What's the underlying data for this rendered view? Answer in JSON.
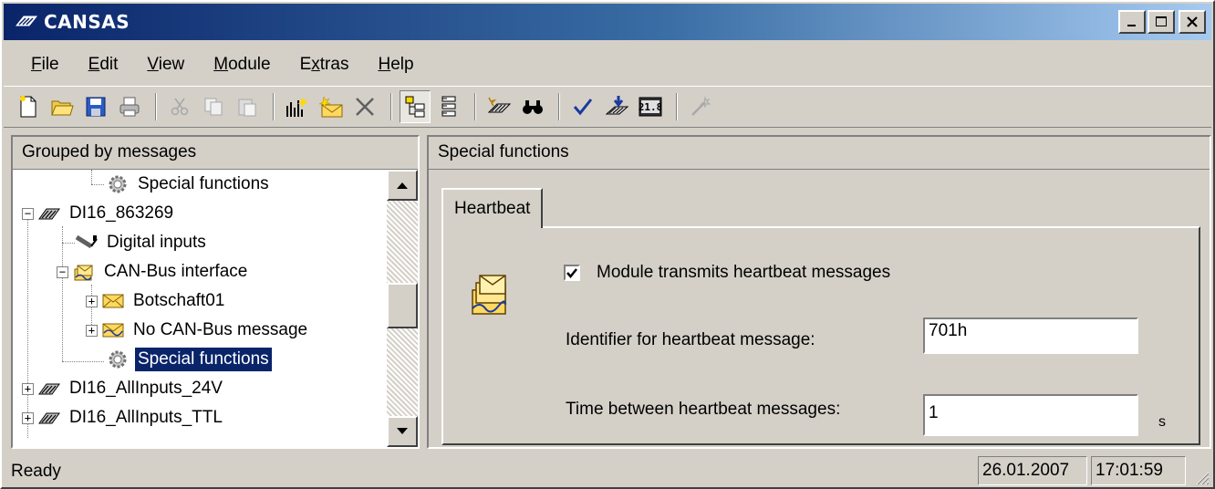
{
  "window": {
    "title": "CANSAS"
  },
  "menu": [
    "File",
    "Edit",
    "View",
    "Module",
    "Extras",
    "Help"
  ],
  "menu_mnemonics": [
    "F",
    "E",
    "V",
    "M",
    "x",
    "H"
  ],
  "toolbar": [
    "new-icon",
    "open-icon",
    "save-icon",
    "print-icon",
    "cut-icon",
    "copy-icon",
    "paste-icon",
    "new-channel-icon",
    "new-message-icon",
    "delete-icon",
    "group-messages-icon",
    "group-channels-icon",
    "module-integrate-icon",
    "find-icon",
    "check-icon",
    "configure-icon",
    "display-icon",
    "disabled-wand-icon"
  ],
  "left_pane": {
    "header": "Grouped by messages",
    "tree": [
      {
        "label": "Special functions",
        "icon": "gear-icon"
      },
      {
        "label": "DI16_863269",
        "icon": "module-icon"
      },
      {
        "label": "Digital inputs",
        "icon": "plug-icon"
      },
      {
        "label": "CAN-Bus interface",
        "icon": "can-bus-icon"
      },
      {
        "label": "Botschaft01",
        "icon": "envelope-icon"
      },
      {
        "label": "No CAN-Bus message",
        "icon": "envelope-crossed-icon"
      },
      {
        "label": "Special functions",
        "icon": "gear-icon",
        "selected": true
      },
      {
        "label": "DI16_AllInputs_24V",
        "icon": "module-icon"
      },
      {
        "label": "DI16_AllInputs_TTL",
        "icon": "module-icon"
      }
    ]
  },
  "right_pane": {
    "header": "Special functions",
    "tab": "Heartbeat",
    "checkbox_label": "Module transmits heartbeat messages",
    "checkbox_checked": true,
    "identifier_label": "Identifier for heartbeat message:",
    "identifier_value": "701h",
    "interval_label": "Time between heartbeat messages:",
    "interval_value": "1",
    "interval_unit": "s"
  },
  "statusbar": {
    "text": "Ready",
    "date": "26.01.2007",
    "time": "17:01:59"
  }
}
